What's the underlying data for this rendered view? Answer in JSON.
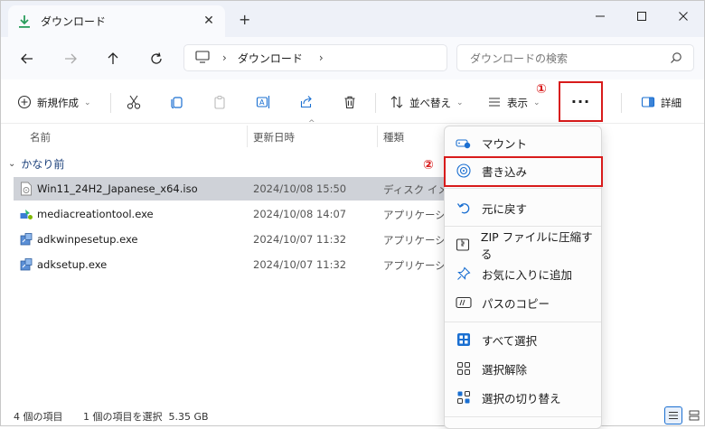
{
  "window": {
    "tab_title": "ダウンロード",
    "tab_close": "✕",
    "new_tab": "+",
    "minimize": "─",
    "maximize": "☐",
    "close": "✕"
  },
  "address_bar": {
    "sep1": "›",
    "crumb": "ダウンロード",
    "sep2": "›",
    "search_placeholder": "ダウンロードの検索"
  },
  "command_bar": {
    "new_label": "新規作成",
    "sort_label": "並べ替え",
    "view_label": "表示",
    "more_label": "···",
    "details_label": "詳細",
    "caret": "⌄"
  },
  "annotations": {
    "badge1": "①",
    "badge2": "②"
  },
  "columns": {
    "name": "名前",
    "date": "更新日時",
    "type": "種類",
    "sort_indicator": "^"
  },
  "group": {
    "label": "かなり前",
    "chevron": "⌄"
  },
  "files": [
    {
      "name": "Win11_24H2_Japanese_x64.iso",
      "date": "2024/10/08 15:50",
      "type": "ディスク イメージ"
    },
    {
      "name": "mediacreationtool.exe",
      "date": "2024/10/08 14:07",
      "type": "アプリケーション"
    },
    {
      "name": "adkwinpesetup.exe",
      "date": "2024/10/07 11:32",
      "type": "アプリケーション"
    },
    {
      "name": "adksetup.exe",
      "date": "2024/10/07 11:32",
      "type": "アプリケーション"
    }
  ],
  "status": {
    "item_count": "4 個の項目",
    "selection": "1 個の項目を選択  5.35 GB"
  },
  "context_menu": {
    "mount": "マウント",
    "burn": "書き込み",
    "undo": "元に戻す",
    "zip": "ZIP ファイルに圧縮する",
    "favorite": "お気に入りに追加",
    "copy_path": "パスのコピー",
    "select_all": "すべて選択",
    "select_none": "選択解除",
    "invert": "選択の切り替え"
  },
  "colors": {
    "highlight_red": "#d81b1b",
    "accent_blue": "#1a6fd1",
    "selection_gray": "#cfd2d8"
  }
}
